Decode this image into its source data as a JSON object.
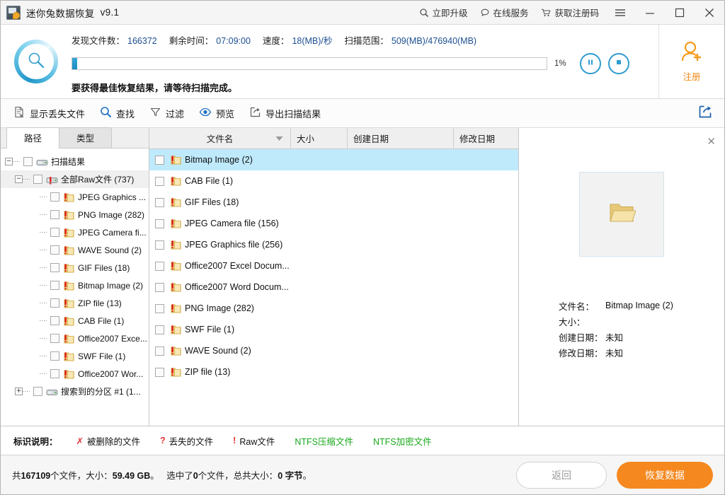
{
  "titlebar": {
    "app_name": "迷你兔数据恢复",
    "version": "v9.1",
    "links": [
      {
        "label": "立即升级",
        "icon": "magnifier-icon"
      },
      {
        "label": "在线服务",
        "icon": "chat-bubble-icon"
      },
      {
        "label": "获取注册码",
        "icon": "cart-icon"
      }
    ],
    "menu_icon": "hamburger-icon",
    "minimize_icon": "minimize-icon",
    "maximize_icon": "maximize-icon",
    "close_icon": "close-icon"
  },
  "scan": {
    "icon": "scan-magnifier-icon",
    "stats": [
      {
        "label": "发现文件数：",
        "value": "166372"
      },
      {
        "label": "剩余时间：",
        "value": "07:09:00"
      },
      {
        "label": "速度：",
        "value": "18(MB)/秒"
      },
      {
        "label": "扫描范围：",
        "value": "509(MB)/476940(MB)"
      }
    ],
    "progress_percent_label": "1%",
    "progress_value": 1,
    "pause_icon": "pause-icon",
    "stop_icon": "stop-icon",
    "note": "要获得最佳恢复结果，请等待扫描完成。",
    "register_label": "注册",
    "register_icon": "user-add-icon",
    "accent_color": "#f18a16",
    "progress_color": "#1b8cc4"
  },
  "toolbar": {
    "items": [
      {
        "label": "显示丢失文件",
        "icon": "document-missing-icon"
      },
      {
        "label": "查找",
        "icon": "search-icon"
      },
      {
        "label": "过滤",
        "icon": "filter-icon"
      },
      {
        "label": "预览",
        "icon": "eye-icon"
      },
      {
        "label": "导出扫描结果",
        "icon": "export-icon"
      }
    ],
    "share_icon": "share-export-icon"
  },
  "tree": {
    "tabs": [
      {
        "label": "路径",
        "active": true
      },
      {
        "label": "类型",
        "active": false
      }
    ],
    "nodes": [
      {
        "label": "扫描结果",
        "depth": 0,
        "expander": "minus",
        "icon": "drive-icon",
        "selected": false
      },
      {
        "label": "全部Raw文件 (737)",
        "depth": 1,
        "expander": "minus",
        "icon": "drive-raw-icon",
        "selected": true
      },
      {
        "label": "JPEG Graphics ...",
        "depth": 2,
        "expander": "none",
        "icon": "folder-raw-icon",
        "selected": false
      },
      {
        "label": "PNG Image (282)",
        "depth": 2,
        "expander": "none",
        "icon": "folder-raw-icon",
        "selected": false
      },
      {
        "label": "JPEG Camera fi...",
        "depth": 2,
        "expander": "none",
        "icon": "folder-raw-icon",
        "selected": false
      },
      {
        "label": "WAVE Sound (2)",
        "depth": 2,
        "expander": "none",
        "icon": "folder-raw-icon",
        "selected": false
      },
      {
        "label": "GIF Files (18)",
        "depth": 2,
        "expander": "none",
        "icon": "folder-raw-icon",
        "selected": false
      },
      {
        "label": "Bitmap Image (2)",
        "depth": 2,
        "expander": "none",
        "icon": "folder-raw-icon",
        "selected": false
      },
      {
        "label": "ZIP file (13)",
        "depth": 2,
        "expander": "none",
        "icon": "folder-raw-icon",
        "selected": false
      },
      {
        "label": "CAB File (1)",
        "depth": 2,
        "expander": "none",
        "icon": "folder-raw-icon",
        "selected": false
      },
      {
        "label": "Office2007 Exce...",
        "depth": 2,
        "expander": "none",
        "icon": "folder-raw-icon",
        "selected": false
      },
      {
        "label": "SWF File (1)",
        "depth": 2,
        "expander": "none",
        "icon": "folder-raw-icon",
        "selected": false
      },
      {
        "label": "Office2007 Wor...",
        "depth": 2,
        "expander": "none",
        "icon": "folder-raw-icon",
        "selected": false
      },
      {
        "label": "搜索到的分区 #1 (1...",
        "depth": 1,
        "expander": "plus",
        "icon": "drive-icon",
        "selected": false
      }
    ]
  },
  "filelist": {
    "columns": [
      {
        "label": "文件名",
        "sorted": true
      },
      {
        "label": "大小",
        "sorted": false
      },
      {
        "label": "创建日期",
        "sorted": false
      },
      {
        "label": "修改日期",
        "sorted": false
      }
    ],
    "sort_icon": "sort-desc-icon",
    "rows": [
      {
        "name": "Bitmap Image (2)",
        "size": "",
        "created": "",
        "modified": "",
        "selected": true
      },
      {
        "name": "CAB File (1)",
        "size": "",
        "created": "",
        "modified": "",
        "selected": false
      },
      {
        "name": "GIF Files (18)",
        "size": "",
        "created": "",
        "modified": "",
        "selected": false
      },
      {
        "name": "JPEG Camera file (156)",
        "size": "",
        "created": "",
        "modified": "",
        "selected": false
      },
      {
        "name": "JPEG Graphics file (256)",
        "size": "",
        "created": "",
        "modified": "",
        "selected": false
      },
      {
        "name": "Office2007 Excel Docum...",
        "size": "",
        "created": "",
        "modified": "",
        "selected": false
      },
      {
        "name": "Office2007 Word Docum...",
        "size": "",
        "created": "",
        "modified": "",
        "selected": false
      },
      {
        "name": "PNG Image (282)",
        "size": "",
        "created": "",
        "modified": "",
        "selected": false
      },
      {
        "name": "SWF File (1)",
        "size": "",
        "created": "",
        "modified": "",
        "selected": false
      },
      {
        "name": "WAVE Sound (2)",
        "size": "",
        "created": "",
        "modified": "",
        "selected": false
      },
      {
        "name": "ZIP file (13)",
        "size": "",
        "created": "",
        "modified": "",
        "selected": false
      }
    ]
  },
  "preview": {
    "close_icon": "close-icon",
    "thumb_icon": "folder-open-icon",
    "fields": [
      {
        "key": "文件名：",
        "value": "Bitmap Image (2)"
      },
      {
        "key": "大小：",
        "value": ""
      },
      {
        "key": "创建日期：",
        "value": "未知"
      },
      {
        "key": "修改日期：",
        "value": "未知"
      }
    ]
  },
  "legend": {
    "title": "标识说明：",
    "items": [
      {
        "mark": "✗",
        "label": "被删除的文件",
        "mark_color": "#e03131",
        "label_color": "#111111"
      },
      {
        "mark": "?",
        "label": "丢失的文件",
        "mark_color": "#e03131",
        "label_color": "#111111"
      },
      {
        "mark": "!",
        "label": "Raw文件",
        "mark_color": "#e03131",
        "label_color": "#111111"
      },
      {
        "mark": "",
        "label": "NTFS压缩文件",
        "mark_color": "#17a81a",
        "label_color": "#17a81a"
      },
      {
        "mark": "",
        "label": "NTFS加密文件",
        "mark_color": "#17a81a",
        "label_color": "#17a81a"
      }
    ]
  },
  "statusbar": {
    "total_prefix": "共",
    "total_files": "167109",
    "total_mid": "个文件，大小：",
    "total_size": "59.49 GB",
    "total_suffix": "。",
    "sel_prefix": "选中了",
    "sel_files": "0",
    "sel_mid": "个文件，总共大小：",
    "sel_size": "0 字节",
    "sel_suffix": "。",
    "back_button": "返回",
    "recover_button": "恢复数据",
    "recover_color": "#f5881f"
  }
}
